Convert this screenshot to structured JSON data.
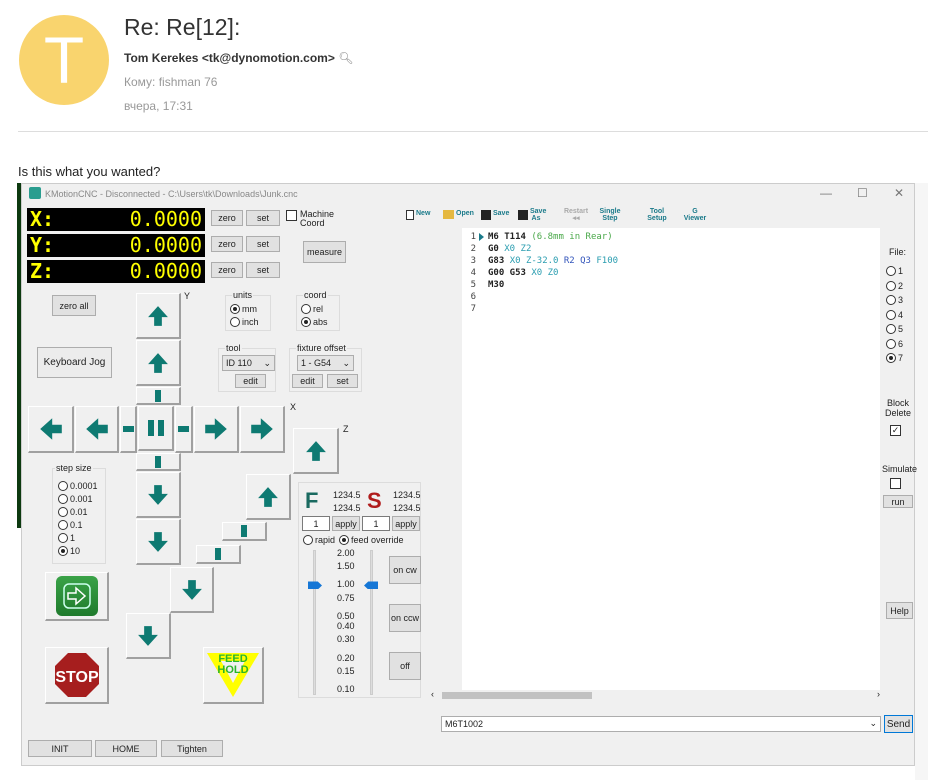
{
  "email": {
    "avatar_letter": "T",
    "subject": "Re: Re[12]:",
    "from": "Tom Kerekes <tk@dynomotion.com>",
    "to": "Кому: fishman 76",
    "date": "вчера, 17:31",
    "body": "Is this what you wanted?"
  },
  "app": {
    "title": "KMotionCNC - Disconnected - C:\\Users\\tk\\Downloads\\Junk.cnc",
    "window_controls": {
      "minimize": "—",
      "maximize": "☐",
      "close": "✕"
    },
    "dro": [
      {
        "axis": "X:",
        "value": "0.0000"
      },
      {
        "axis": "Y:",
        "value": "0.0000"
      },
      {
        "axis": "Z:",
        "value": "0.0000"
      }
    ],
    "zero_label": "zero",
    "set_label": "set",
    "machine_coord": "Machine Coord",
    "measure": "measure",
    "zero_all": "zero all",
    "keyboard_jog": "Keyboard Jog",
    "units": {
      "label": "units",
      "options": [
        "mm",
        "inch"
      ],
      "selected": "mm"
    },
    "coord": {
      "label": "coord",
      "options": [
        "rel",
        "abs"
      ],
      "selected": "abs"
    },
    "tool": {
      "label": "tool",
      "value": "ID 110",
      "edit": "edit"
    },
    "fixture": {
      "label": "fixture offset",
      "value": "1 - G54",
      "edit": "edit",
      "set": "set"
    },
    "axis_labels": {
      "y": "Y",
      "x": "X",
      "z": "Z"
    },
    "step_size": {
      "label": "step size",
      "options": [
        "0.0001",
        "0.001",
        "0.01",
        "0.1",
        "1",
        "10"
      ],
      "selected": "10"
    },
    "stop": "STOP",
    "feed_hold": "FEED HOLD",
    "feed": {
      "letter": "F",
      "v1": "1234.5",
      "v2": "1234.5",
      "input": "1",
      "apply": "apply"
    },
    "spindle": {
      "letter": "S",
      "v1": "1234.5",
      "v2": "1234.5",
      "input": "1",
      "apply": "apply"
    },
    "rapid": "rapid",
    "feed_override": "feed override",
    "override_ticks": [
      "2.00",
      "1.50",
      "1.00",
      "0.75",
      "0.50",
      "0.40",
      "0.30",
      "0.20",
      "0.15",
      "0.10"
    ],
    "feed_override_value": 1.0,
    "spindle_override_value": 1.0,
    "spindle_buttons": {
      "cw": "on cw",
      "ccw": "on ccw",
      "off": "off"
    },
    "toolbar": {
      "new": "New",
      "open": "Open",
      "save": "Save",
      "save_as": "Save As",
      "restart": "Restart",
      "single_step": "Single Step",
      "tool_setup": "Tool Setup",
      "g_viewer": "G Viewer"
    },
    "code_lines": [
      [
        {
          "t": "M6 T114 ",
          "c": "kw"
        },
        {
          "t": "(6.8mm in Rear)",
          "c": "cm"
        }
      ],
      [
        {
          "t": "G0 ",
          "c": "kw"
        },
        {
          "t": "X0 Z2",
          "c": "ax"
        }
      ],
      [
        {
          "t": "G83 ",
          "c": "kw"
        },
        {
          "t": "X0 Z-32.0 ",
          "c": "ax"
        },
        {
          "t": "R2 Q3 ",
          "c": "pr"
        },
        {
          "t": "F100",
          "c": "ax"
        }
      ],
      [
        {
          "t": "G00 G53 ",
          "c": "kw"
        },
        {
          "t": "X0 Z0",
          "c": "ax"
        }
      ],
      [
        {
          "t": "M30",
          "c": "kw"
        }
      ],
      [],
      []
    ],
    "line_numbers": [
      "1",
      "2",
      "3",
      "4",
      "5",
      "6",
      "7"
    ],
    "file": {
      "label": "File:",
      "options": [
        "1",
        "2",
        "3",
        "4",
        "5",
        "6",
        "7"
      ],
      "selected": "7"
    },
    "block_delete": "Block Delete",
    "simulate": "Simulate",
    "run": "run",
    "help": "Help",
    "command": "M6T1002",
    "send": "Send",
    "bottom": {
      "init": "INIT",
      "home": "HOME",
      "tighten": "Tighten"
    }
  },
  "colors": {
    "arrow": "#0e7a72",
    "dro_text": "#ffff00",
    "avatar": "#f9d46e",
    "accent": "#1677d6"
  }
}
